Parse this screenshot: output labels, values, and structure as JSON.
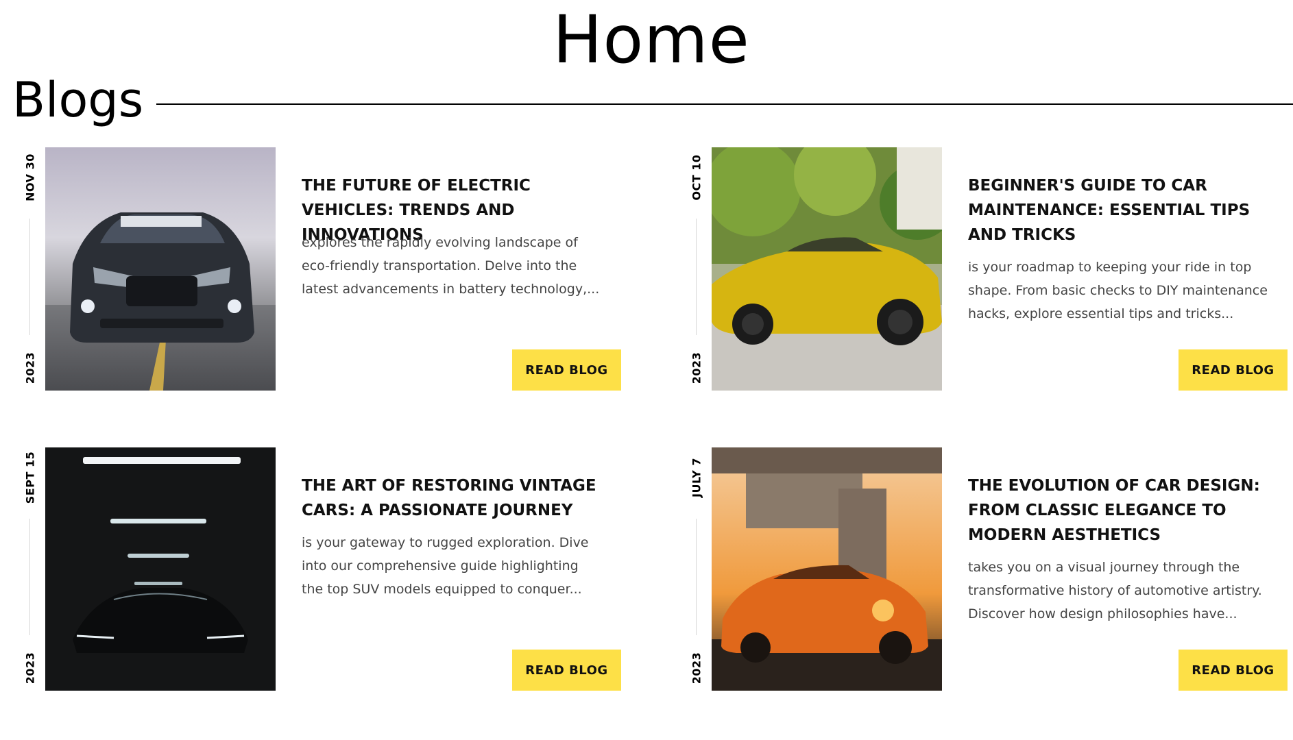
{
  "page": {
    "title": "Home",
    "section_title": "Blogs"
  },
  "colors": {
    "button_background": "#fde047",
    "heading_text": "#111111",
    "body_text": "#444444",
    "rule": "#000000"
  },
  "blogs": [
    {
      "date": "NOV 30",
      "year": "2023",
      "title": "THE FUTURE OF ELECTRIC VEHICLES: TRENDS AND INNOVATIONS",
      "excerpt": "explores the rapidly evolving landscape of eco-friendly transportation. Delve into the latest advancements in battery technology,...",
      "button_label": "READ BLOG",
      "image": "dark-muscle-car-front-photo"
    },
    {
      "date": "OCT 10",
      "year": "2023",
      "title": "BEGINNER'S GUIDE TO CAR MAINTENANCE: ESSENTIAL TIPS AND TRICKS",
      "excerpt": "is your roadmap to keeping your ride in top shape. From basic checks to DIY maintenance hacks, explore essential tips and tricks...",
      "button_label": "READ BLOG",
      "image": "yellow-sports-car-photo"
    },
    {
      "date": "SEPT 15",
      "year": "2023",
      "title": "THE ART OF RESTORING VINTAGE CARS: A PASSIONATE JOURNEY",
      "excerpt": "is your gateway to rugged exploration. Dive into our comprehensive guide highlighting the top SUV models equipped to conquer...",
      "button_label": "READ BLOG",
      "image": "dark-car-in-garage-photo"
    },
    {
      "date": "JULY 7",
      "year": "2023",
      "title": "THE EVOLUTION OF CAR DESIGN: FROM CLASSIC ELEGANCE TO MODERN AESTHETICS",
      "excerpt": "takes you on a visual journey through the transformative history of automotive artistry. Discover how design philosophies have...",
      "button_label": "READ BLOG",
      "image": "orange-coupe-sunset-photo"
    }
  ]
}
